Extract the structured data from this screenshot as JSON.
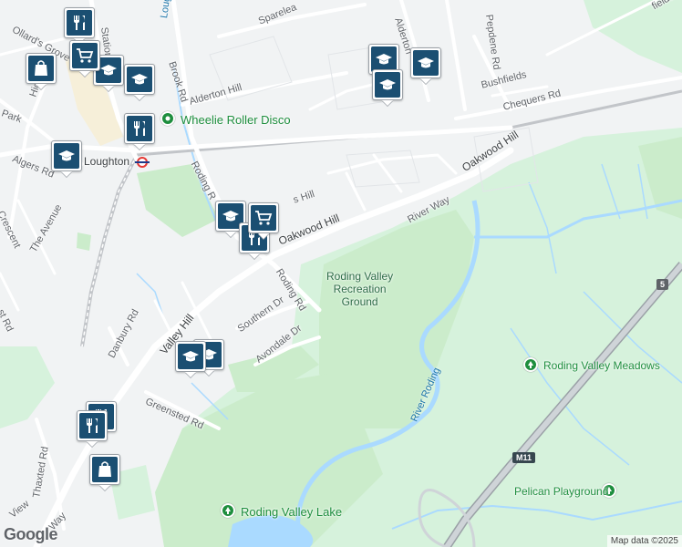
{
  "map": {
    "attribution": "Map data ©2025",
    "logo": "Google"
  },
  "roads": {
    "oakwood_hill_1": "Oakwood Hill",
    "oakwood_hill_2": "Oakwood Hill",
    "river_way": "River Way",
    "roding_rd": "Roding Rd",
    "roding_rd_2": "Roding R",
    "southern_dr": "Southern Dr",
    "avondale_dr": "Avondale Dr",
    "valley_hill": "Valley Hill",
    "danbury_rd": "Danbury Rd",
    "greensted_rd": "Greensted Rd",
    "thaxted_rd": "Thaxted Rd",
    "the_avenue": "The Avenue",
    "algers_rd": "Algers Rd",
    "ollards_grove": "Ollard's Grove",
    "high_rd": "High Rd",
    "station": "Station",
    "brook_rd": "Brook Rd",
    "alderton_hill": "Alderton Hill",
    "alderton": "Alderton",
    "sparelea": "Sparelea",
    "chequers_rd": "Chequers Rd",
    "bushfields": "Bushfields",
    "pepdene_rd": "Pepdene Rd",
    "fields": "fields",
    "crescent": "Crescent",
    "park": "Park",
    "st_rd": "st Rd",
    "loughton_top": "Loughton",
    "hill_frag": "s Hill",
    "view": "View",
    "way": "Way"
  },
  "places": {
    "rec_ground": "Roding Valley Recreation Ground",
    "rec_ground_line1": "Roding Valley",
    "rec_ground_line2": "Recreation",
    "rec_ground_line3": "Ground",
    "meadows": "Roding Valley Meadows",
    "lake": "Roding Valley Lake",
    "playground": "Pelican Playground",
    "roller_disco": "Wheelie Roller Disco",
    "loughton_station": "Loughton",
    "river_roding": "River Roding"
  },
  "shields": {
    "m11": "M11",
    "m11_num": "5"
  },
  "markers": [
    {
      "type": "school",
      "icon": "school-icon"
    },
    {
      "type": "restaurant",
      "icon": "restaurant-icon"
    },
    {
      "type": "shopping",
      "icon": "shopping-cart-icon"
    },
    {
      "type": "shopping-bag",
      "icon": "shopping-bag-icon"
    }
  ],
  "colors": {
    "park": "#cbeccb",
    "green_light": "#d6f2dc",
    "water": "#aadaff",
    "road": "#ffffff",
    "land": "#f1f3f4",
    "marker": "#1b4f72",
    "poi_green": "#1e8e3e"
  }
}
